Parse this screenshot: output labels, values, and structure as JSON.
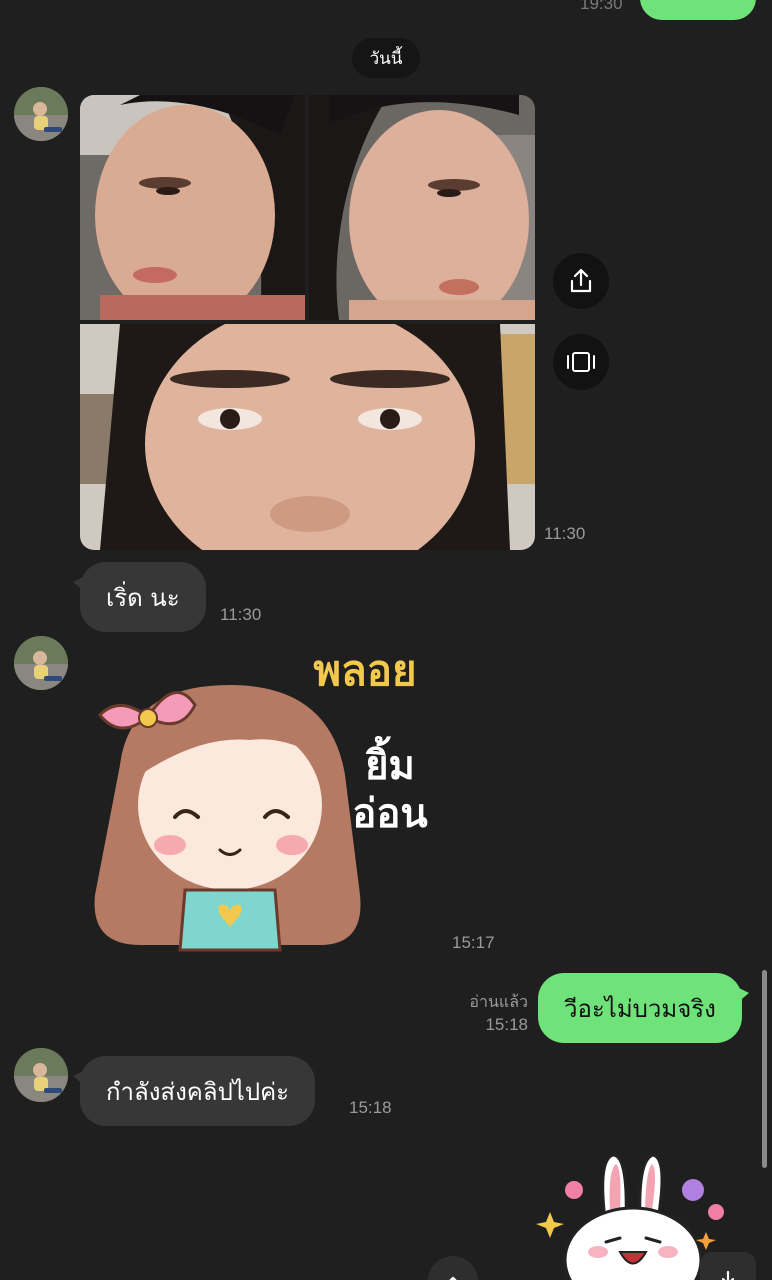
{
  "top_partial": {
    "time": "19:30"
  },
  "date_separator": {
    "label": "วันนี้"
  },
  "messages": {
    "photo_album": {
      "time": "11:30"
    },
    "text_1": {
      "text": "เริ่ด นะ",
      "time": "11:30"
    },
    "sticker_1": {
      "time": "15:17",
      "caption_lines": [
        "พลอย",
        "ยิ้ม",
        "อ่อน"
      ]
    },
    "outgoing_1": {
      "text": "วีอะไม่บวมจริง",
      "read_label": "อ่านแล้ว",
      "time": "15:18"
    },
    "text_2": {
      "text": "กำลังส่งคลิปไปค่ะ",
      "time": "15:18"
    }
  },
  "icons": {
    "share": "share-icon",
    "album_view": "album-view-icon",
    "scroll_up": "chevron-up-icon",
    "download": "download-icon"
  },
  "colors": {
    "background": "#1f1f1f",
    "incoming_bubble": "#373737",
    "outgoing_bubble": "#6fe37a",
    "timestamp": "#9a9a9a"
  }
}
